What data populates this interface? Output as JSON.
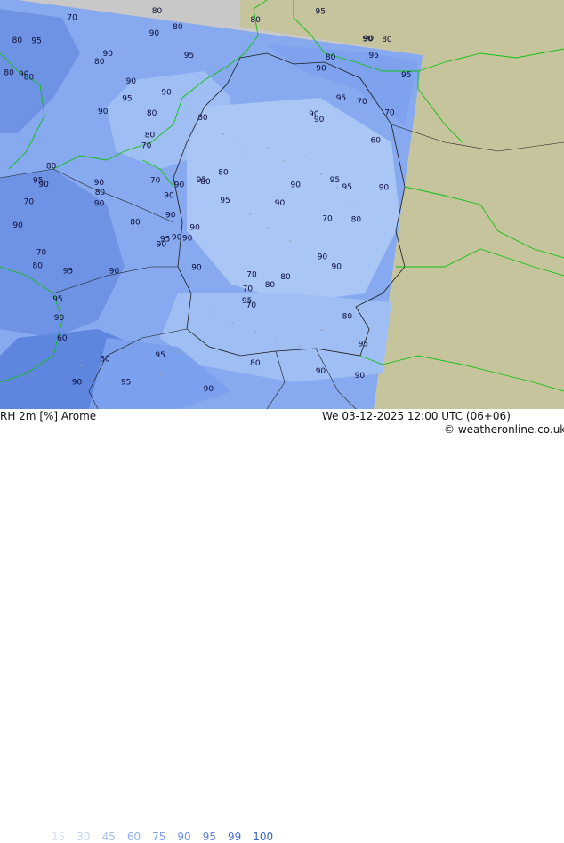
{
  "map": {
    "contour_labels": [
      "95",
      "90",
      "80",
      "90",
      "95",
      "90",
      "80",
      "90",
      "95",
      "90",
      "80",
      "90",
      "95",
      "90",
      "80",
      "90",
      "95",
      "90",
      "80",
      "90",
      "70",
      "80",
      "70",
      "80",
      "90",
      "70",
      "80",
      "90",
      "80",
      "70",
      "95",
      "95",
      "95",
      "90",
      "90",
      "95",
      "90",
      "95",
      "90",
      "95",
      "90",
      "80",
      "90",
      "80",
      "70",
      "80",
      "90",
      "95",
      "90",
      "80",
      "80",
      "70",
      "80",
      "90",
      "95",
      "90",
      "80",
      "70",
      "60",
      "70",
      "80",
      "90",
      "95",
      "90",
      "80",
      "70",
      "80",
      "90",
      "95",
      "90",
      "60",
      "70",
      "80",
      "90",
      "95",
      "90",
      "80",
      "70",
      "80",
      "90",
      "95",
      "90",
      "80",
      "90",
      "95",
      "90",
      "80",
      "90",
      "95",
      "90"
    ],
    "colors": {
      "ocean_land_gray": "#c8c8c8",
      "land_tan": "#c6c49c",
      "rh_95": "#6f93e4",
      "rh_90": "#86a9ef",
      "rh_80": "#9fbff4",
      "rh_70": "#a9c6f4",
      "border_green": "#10c010",
      "country_border": "#1a1a1a"
    }
  },
  "footer": {
    "title": "RH 2m [%] Arome",
    "datetime": "We 03-12-2025 12:00 UTC (06+06)",
    "credit": "© weatheronline.co.uk",
    "legend": [
      {
        "label": "15",
        "color": "#d8e2f4"
      },
      {
        "label": "30",
        "color": "#c2d3ef"
      },
      {
        "label": "45",
        "color": "#aac0ea"
      },
      {
        "label": "60",
        "color": "#8fb0f4"
      },
      {
        "label": "75",
        "color": "#7aa0ee"
      },
      {
        "label": "90",
        "color": "#6a92e6"
      },
      {
        "label": "95",
        "color": "#5b83dd"
      },
      {
        "label": "99",
        "color": "#4a72d4"
      },
      {
        "label": "100",
        "color": "#3a62c8"
      }
    ]
  }
}
